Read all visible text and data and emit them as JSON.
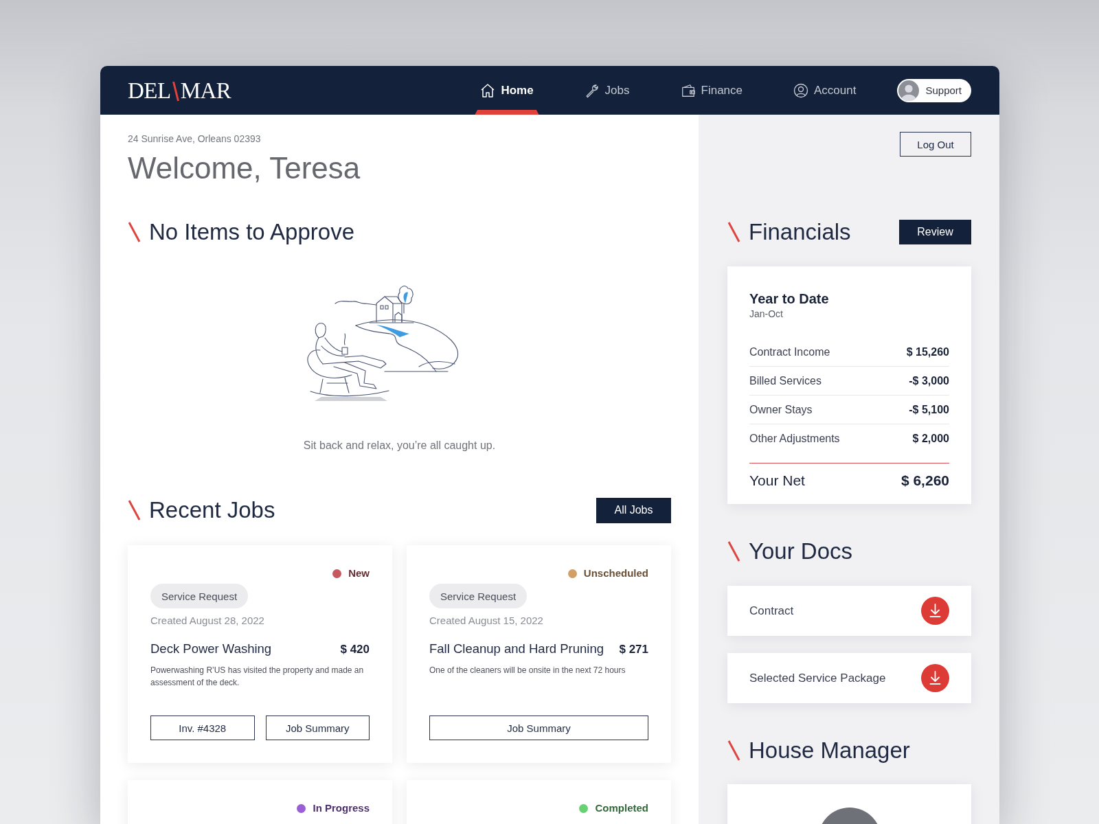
{
  "header": {
    "logo": {
      "left": "DEL",
      "right": "MAR"
    },
    "nav": [
      {
        "label": "Home",
        "selected": true
      },
      {
        "label": "Jobs",
        "selected": false
      },
      {
        "label": "Finance",
        "selected": false
      },
      {
        "label": "Account",
        "selected": false
      }
    ],
    "support": {
      "label": "Support"
    }
  },
  "main": {
    "address": "24 Sunrise Ave, Orleans 02393",
    "greeting": "Welcome, Teresa",
    "approvals": {
      "title": "No Items to Approve",
      "caption": "Sit back and relax, you’re all caught up."
    },
    "recent_jobs": {
      "title": "Recent Jobs",
      "button": "All Jobs",
      "jobs": [
        {
          "status": "New",
          "color": "#c75860",
          "tag": "Service Request",
          "created": "Created August 28, 2022",
          "title": "Deck Power Washing",
          "price": "$ 420",
          "description": "Powerwashing R’US has visited the property and made an assessment of the deck.",
          "buttons": [
            "Inv. #4328",
            "Job Summary"
          ]
        },
        {
          "status": "Unscheduled",
          "color": "#d2a067",
          "tag": "Service Request",
          "created": "Created August 15, 2022",
          "title": "Fall Cleanup and Hard Pruning",
          "price": "$ 271",
          "description": "One of the cleaners will be onsite in the next 72 hours",
          "buttons": [
            "Job Summary"
          ]
        },
        {
          "status": "In Progress",
          "color": "#9a5ed6"
        },
        {
          "status": "Completed",
          "color": "#67d173"
        }
      ]
    }
  },
  "sidebar": {
    "logout": "Log Out",
    "financials": {
      "title": "Financials",
      "button": "Review",
      "card_title": "Year to Date",
      "period": "Jan-Oct",
      "rows": [
        {
          "label": "Contract Income",
          "value": "$ 15,260"
        },
        {
          "label": "Billed Services",
          "value": "-$ 3,000"
        },
        {
          "label": "Owner Stays",
          "value": "-$ 5,100"
        },
        {
          "label": "Other Adjustments",
          "value": "$ 2,000"
        }
      ],
      "total": {
        "label": "Your Net",
        "value": "$ 6,260"
      }
    },
    "docs": {
      "title": "Your Docs",
      "items": [
        {
          "label": "Contract"
        },
        {
          "label": "Selected Service Package"
        }
      ]
    },
    "house_manager": {
      "title": "House Manager"
    }
  }
}
